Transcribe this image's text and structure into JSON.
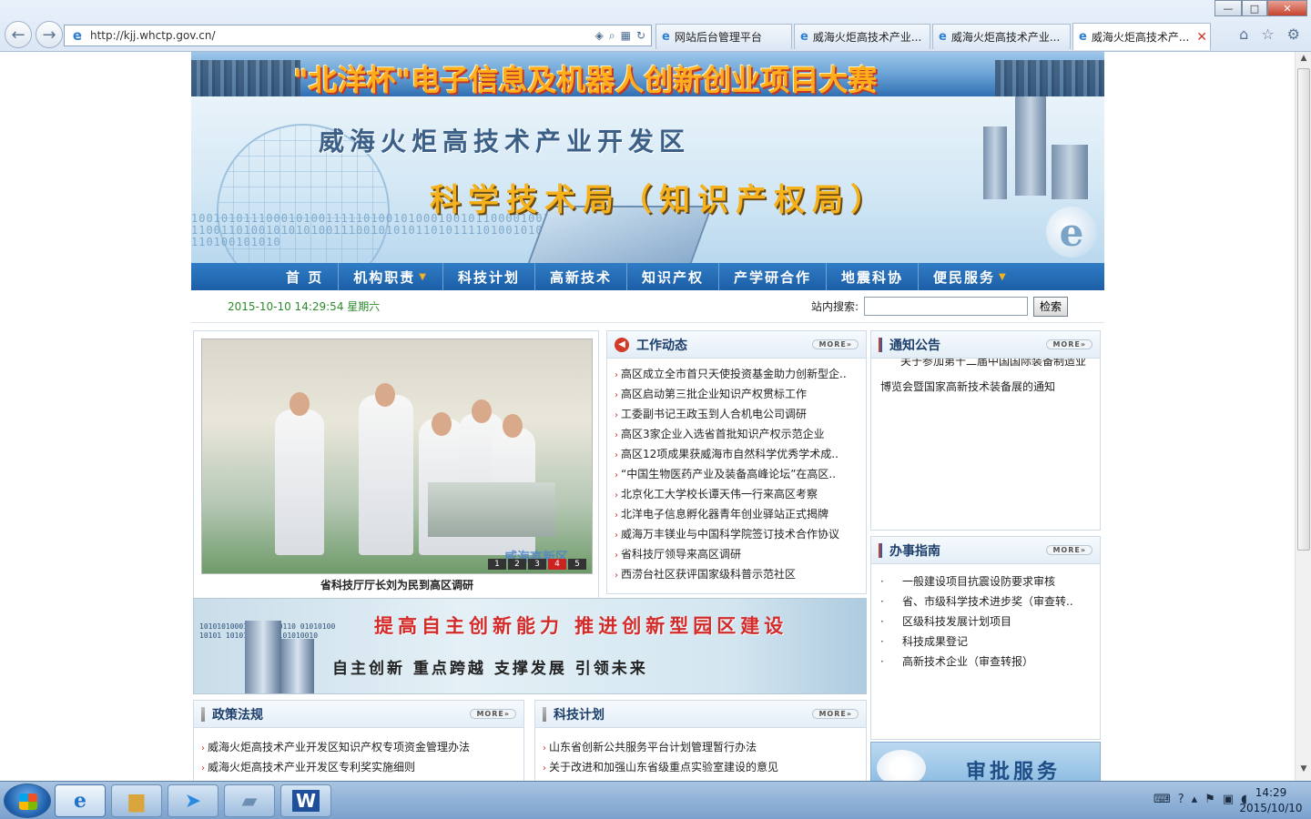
{
  "browser": {
    "url": "http://kjj.whctp.gov.cn/",
    "tabs": [
      {
        "label": "网站后台管理平台"
      },
      {
        "label": "威海火炬高技术产业..."
      },
      {
        "label": "威海火炬高技术产业..."
      },
      {
        "label": "威海火炬高技术产..."
      }
    ],
    "win_controls": {
      "minimize": "—",
      "maximize": "□",
      "close": "✕"
    }
  },
  "page": {
    "top_banner": "\"北洋杯\"电子信息及机器人创新创业项目大赛",
    "hero": {
      "zone": "威海火炬高技术产业开发区",
      "bureau": "科学技术局（知识产权局）",
      "binary": "1001010111000101001111101001010001001011000010010111010101111001101011001101001010101001110010101011010111101001010010111010100101011100110100101010",
      "logo_letter": "e"
    },
    "nav": [
      {
        "label": "首  页",
        "caret": false
      },
      {
        "label": "机构职责",
        "caret": true
      },
      {
        "label": "科技计划",
        "caret": false
      },
      {
        "label": "高新技术",
        "caret": false
      },
      {
        "label": "知识产权",
        "caret": false
      },
      {
        "label": "产学研合作",
        "caret": false
      },
      {
        "label": "地震科协",
        "caret": false
      },
      {
        "label": "便民服务",
        "caret": true
      }
    ],
    "status": {
      "datetime": "2015-10-10 14:29:54 星期六",
      "search_label": "站内搜索:",
      "search_value": "",
      "search_button": "检索"
    },
    "photo": {
      "caption": "省科技厅厅长刘为民到高区调研",
      "watermark": "威海高新区",
      "pages": [
        "1",
        "2",
        "3",
        "4",
        "5"
      ],
      "active_page": "4"
    },
    "work_news": {
      "title": "工作动态",
      "more": "MORE»",
      "items": [
        "高区成立全市首只天使投资基金助力创新型企..",
        "高区启动第三批企业知识产权贯标工作",
        "工委副书记王政玉到人合机电公司调研",
        "高区3家企业入选省首批知识产权示范企业",
        "高区12项成果获威海市自然科学优秀学术成..",
        "“中国生物医药产业及装备高峰论坛”在高区..",
        "北京化工大学校长谭天伟一行来高区考察",
        "北洋电子信息孵化器青年创业驿站正式揭牌",
        "威海万丰镁业与中国科学院签订技术合作协议",
        "省科技厅领导来高区调研",
        "西涝台社区获评国家级科普示范社区"
      ]
    },
    "notice": {
      "title": "通知公告",
      "more": "MORE»",
      "line_partial": "关于参加第十二届中国国际装备制造业",
      "line2": "博览会暨国家高新技术装备展的通知"
    },
    "guide": {
      "title": "办事指南",
      "more": "MORE»",
      "items": [
        "一般建设项目抗震设防要求审核",
        "省、市级科学技术进步奖（审查转..",
        "区级科技发展计划项目",
        "科技成果登记",
        "高新技术企业（审查转报）"
      ]
    },
    "mid_banner": {
      "line1": "提高自主创新能力  推进创新型园区建设",
      "line2": "自主创新  重点跨越  支撑发展  引领未来",
      "binary": "1010101000101001010110 0101010010101 1010101010 0101010010"
    },
    "policy": {
      "title": "政策法规",
      "more": "MORE»",
      "items": [
        "威海火炬高技术产业开发区知识产权专项资金管理办法",
        "威海火炬高技术产业开发区专利奖实施细则"
      ]
    },
    "plan": {
      "title": "科技计划",
      "more": "MORE»",
      "items": [
        "山东省创新公共服务平台计划管理暂行办法",
        "关于改进和加强山东省级重点实验室建设的意见"
      ]
    },
    "approval": {
      "label": "审批服务"
    }
  },
  "taskbar": {
    "clock_time": "14:29",
    "clock_date": "2015/10/10"
  }
}
